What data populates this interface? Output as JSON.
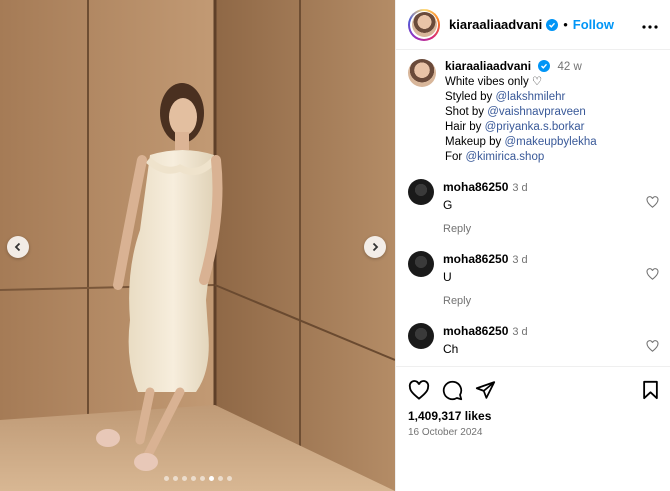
{
  "post": {
    "username": "kiaraaliaadvani",
    "follow_label": "Follow",
    "separator": "•",
    "more_label": "•••",
    "caption": {
      "username": "kiaraaliaadvani",
      "time": "42 w",
      "line1": "White vibes only ♡",
      "styled_prefix": "Styled by ",
      "styled_by": "@lakshmilehr",
      "shot_prefix": "Shot by ",
      "shot_by": "@vaishnavpraveen",
      "hair_prefix": "Hair by ",
      "hair_by": "@priyanka.s.borkar",
      "makeup_prefix": "Makeup by ",
      "makeup_by": "@makeupbylekha",
      "for_prefix": "For ",
      "for": "@kimirica.shop"
    },
    "comments": [
      {
        "username": "moha86250",
        "time": "3 d",
        "text": "G",
        "reply_label": "Reply"
      },
      {
        "username": "moha86250",
        "time": "3 d",
        "text": "U",
        "reply_label": "Reply"
      },
      {
        "username": "moha86250",
        "time": "3 d",
        "text": "Ch",
        "reply_label": ""
      }
    ],
    "likes": "1,409,317 likes",
    "date": "16 October 2024"
  },
  "carousel": {
    "count": 8,
    "active_index": 5
  },
  "icons": [
    "verified-icon",
    "more-icon",
    "chevron-left-icon",
    "chevron-right-icon",
    "heart-icon",
    "comment-icon",
    "share-icon",
    "bookmark-icon"
  ],
  "colors": {
    "accent": "#0095f6",
    "muted": "#737373",
    "mention": "#00376b"
  }
}
